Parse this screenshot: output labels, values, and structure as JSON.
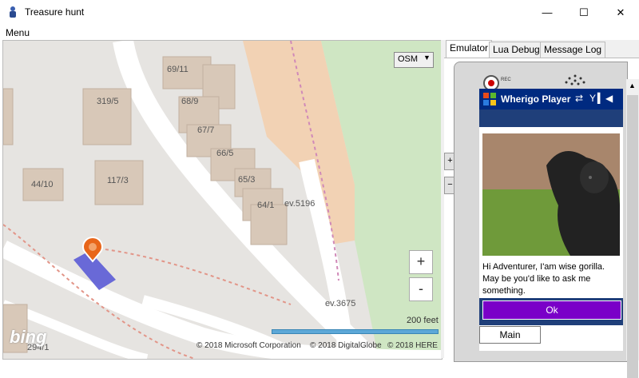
{
  "window": {
    "title": "Treasure hunt",
    "minimize_glyph": "—",
    "maximize_glyph": "☐",
    "close_glyph": "✕",
    "icon": "player-icon"
  },
  "menu": {
    "label": "Menu"
  },
  "map": {
    "layer_select": "OSM",
    "zoom_in": "+",
    "zoom_out": "-",
    "scale_label": "200 feet",
    "logo": "bing",
    "copyright": [
      "© 2018 Microsoft Corporation",
      "© 2018 DigitalGlobe",
      "© 2018 HERE"
    ],
    "building_labels": [
      "69/11",
      "319/5",
      "68/9",
      "67/7",
      "66/5",
      "44/10",
      "117/3",
      "65/3",
      "64/1",
      "ev.5196",
      "ev.3675",
      "294/1"
    ]
  },
  "tabs": [
    "Emulator",
    "Lua Debug",
    "Message Log"
  ],
  "emulator": {
    "side_plus": "+",
    "side_minus": "−",
    "rec_label": "REC",
    "app_title": "Wherigo Player",
    "message": "Hi Adventurer, I'am wise gorilla. May be you'd like to ask me something.",
    "ok_label": "Ok",
    "main_label": "Main",
    "colors": {
      "taskbar": "#002a80",
      "ok_button": "#7a00c8",
      "band": "#1f3f7a"
    }
  }
}
